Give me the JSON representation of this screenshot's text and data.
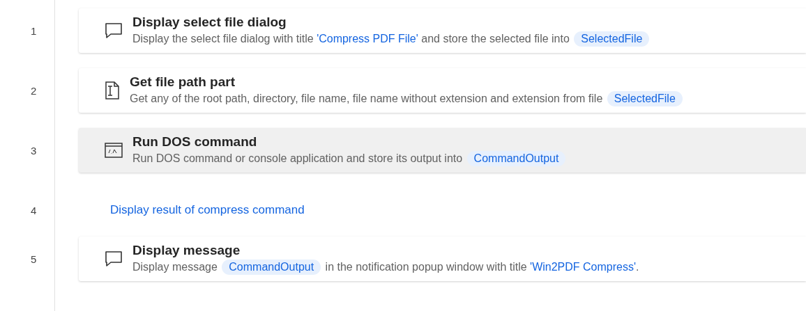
{
  "steps": [
    {
      "number": "1",
      "kind": "message",
      "selected": false,
      "title": "Display select file dialog",
      "description": [
        {
          "kind": "text",
          "text": "Display the select file dialog with title "
        },
        {
          "kind": "string",
          "text": "'Compress PDF File'"
        },
        {
          "kind": "text",
          "text": " and store the selected file into "
        },
        {
          "kind": "variable",
          "text": "SelectedFile"
        }
      ]
    },
    {
      "number": "2",
      "kind": "file-path",
      "selected": false,
      "title": "Get file path part",
      "description": [
        {
          "kind": "text",
          "text": "Get any of the root path, directory, file name, file name without extension and extension from file "
        },
        {
          "kind": "variable",
          "text": "SelectedFile"
        }
      ]
    },
    {
      "number": "3",
      "kind": "dos",
      "selected": true,
      "title": "Run DOS command",
      "description": [
        {
          "kind": "text",
          "text": "Run DOS command or console application and store its output into "
        },
        {
          "kind": "variable",
          "text": "CommandOutput"
        }
      ]
    },
    {
      "number": "4",
      "kind": "comment",
      "title": "Display result of compress command"
    },
    {
      "number": "5",
      "kind": "message",
      "selected": false,
      "title": "Display message",
      "description": [
        {
          "kind": "text",
          "text": "Display message "
        },
        {
          "kind": "variable",
          "text": "CommandOutput"
        },
        {
          "kind": "text",
          "text": " in the notification popup window with title "
        },
        {
          "kind": "string",
          "text": "'Win2PDF Compress'"
        },
        {
          "kind": "text",
          "text": "."
        }
      ]
    }
  ]
}
